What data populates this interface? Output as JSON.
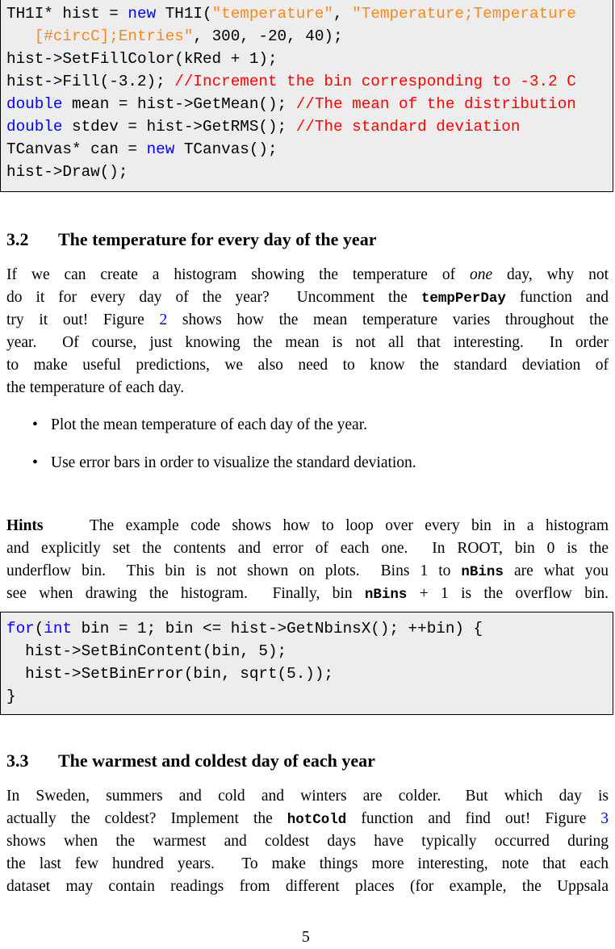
{
  "code_block_1": [
    [
      [
        "n",
        "TH1I* hist = "
      ],
      [
        "k",
        "new"
      ],
      [
        "n",
        " TH1I("
      ],
      [
        "s",
        "\"temperature\""
      ],
      [
        "n",
        ", "
      ],
      [
        "s",
        "\"Temperature;Temperature"
      ]
    ],
    [
      [
        "s",
        "   [#circC];Entries\""
      ],
      [
        "n",
        ", 300, -20, 40);"
      ]
    ],
    [
      [
        "n",
        "hist->SetFillColor(kRed + 1);"
      ]
    ],
    [
      [
        "n",
        "hist->Fill(-3.2); "
      ],
      [
        "c",
        "//Increment the bin corresponding to -3.2 C"
      ]
    ],
    [
      [
        "k",
        "double"
      ],
      [
        "n",
        " mean = hist->GetMean(); "
      ],
      [
        "c",
        "//The mean of the distribution"
      ]
    ],
    [
      [
        "k",
        "double"
      ],
      [
        "n",
        " stdev = hist->GetRMS(); "
      ],
      [
        "c",
        "//The standard deviation"
      ]
    ],
    [
      [
        "n",
        "TCanvas* can = "
      ],
      [
        "k",
        "new"
      ],
      [
        "n",
        " TCanvas();"
      ]
    ],
    [
      [
        "n",
        "hist->Draw();"
      ]
    ]
  ],
  "section_3_2": {
    "number": "3.2",
    "title": "The temperature for every day of the year",
    "paragraph": [
      [
        [
          "n",
          "If we can create a histogram showing the temperature of "
        ],
        [
          "i",
          "one"
        ],
        [
          "n",
          " day, why not"
        ]
      ],
      [
        [
          "n",
          "do it for every day of the year?  Uncomment the "
        ],
        [
          "m",
          "tempPerDay"
        ],
        [
          "n",
          " function and"
        ]
      ],
      [
        [
          "n",
          "try it out! Figure "
        ],
        [
          "l",
          "2"
        ],
        [
          "n",
          " shows how the mean temperature varies throughout the"
        ]
      ],
      [
        [
          "n",
          "year.  Of course, just knowing the mean is not all that interesting.  In order"
        ]
      ],
      [
        [
          "n",
          "to make useful predictions, we also need to know the standard deviation of"
        ]
      ],
      [
        [
          "n",
          "the temperature of each day."
        ]
      ]
    ],
    "bullets": [
      "Plot the mean temperature of each day of the year.",
      "Use error bars in order to visualize the standard deviation."
    ],
    "hints": [
      [
        [
          "b",
          "Hints"
        ],
        [
          "n",
          "    The example code shows how to loop over every bin in a histogram"
        ]
      ],
      [
        [
          "n",
          "and explicitly set the contents and error of each one.  In ROOT, bin 0 is the"
        ]
      ],
      [
        [
          "n",
          "underflow bin.  This bin is not shown on plots.  Bins 1 to "
        ],
        [
          "m",
          "nBins"
        ],
        [
          "n",
          " are what you"
        ]
      ],
      [
        [
          "n",
          "see when drawing the histogram.  Finally, bin "
        ],
        [
          "m",
          "nBins"
        ],
        [
          "n",
          " + 1 is the overflow bin."
        ]
      ]
    ]
  },
  "code_block_2": [
    [
      [
        "k",
        "for"
      ],
      [
        "n",
        "("
      ],
      [
        "k",
        "int"
      ],
      [
        "n",
        " bin = 1; bin <= hist->GetNbinsX(); ++bin) {"
      ]
    ],
    [
      [
        "n",
        "  hist->SetBinContent(bin, 5);"
      ]
    ],
    [
      [
        "n",
        "  hist->SetBinError(bin, sqrt(5.));"
      ]
    ],
    [
      [
        "n",
        "}"
      ]
    ]
  ],
  "section_3_3": {
    "number": "3.3",
    "title": "The warmest and coldest day of each year",
    "paragraph": [
      [
        [
          "n",
          "In  Sweden,  summers  and  cold  and  winters  are  colder.   But  which  day  is"
        ]
      ],
      [
        [
          "n",
          "actually the coldest? Implement the "
        ],
        [
          "m",
          "hotCold"
        ],
        [
          "n",
          " function and find out! Figure "
        ],
        [
          "l",
          "3"
        ]
      ],
      [
        [
          "n",
          "shows  when  the  warmest  and  coldest  days  have  typically  occurred  during"
        ]
      ],
      [
        [
          "n",
          "the last few hundred years.  To make things more interesting, note that each"
        ]
      ],
      [
        [
          "n",
          "dataset may contain readings from different places (for example, the Uppsala"
        ]
      ]
    ]
  },
  "page_number": "5",
  "colors": {
    "keyword": "#0000ff",
    "string": "#f5891f",
    "comment": "#ff0000",
    "link": "#0000ff",
    "code_background": "#ededed"
  }
}
